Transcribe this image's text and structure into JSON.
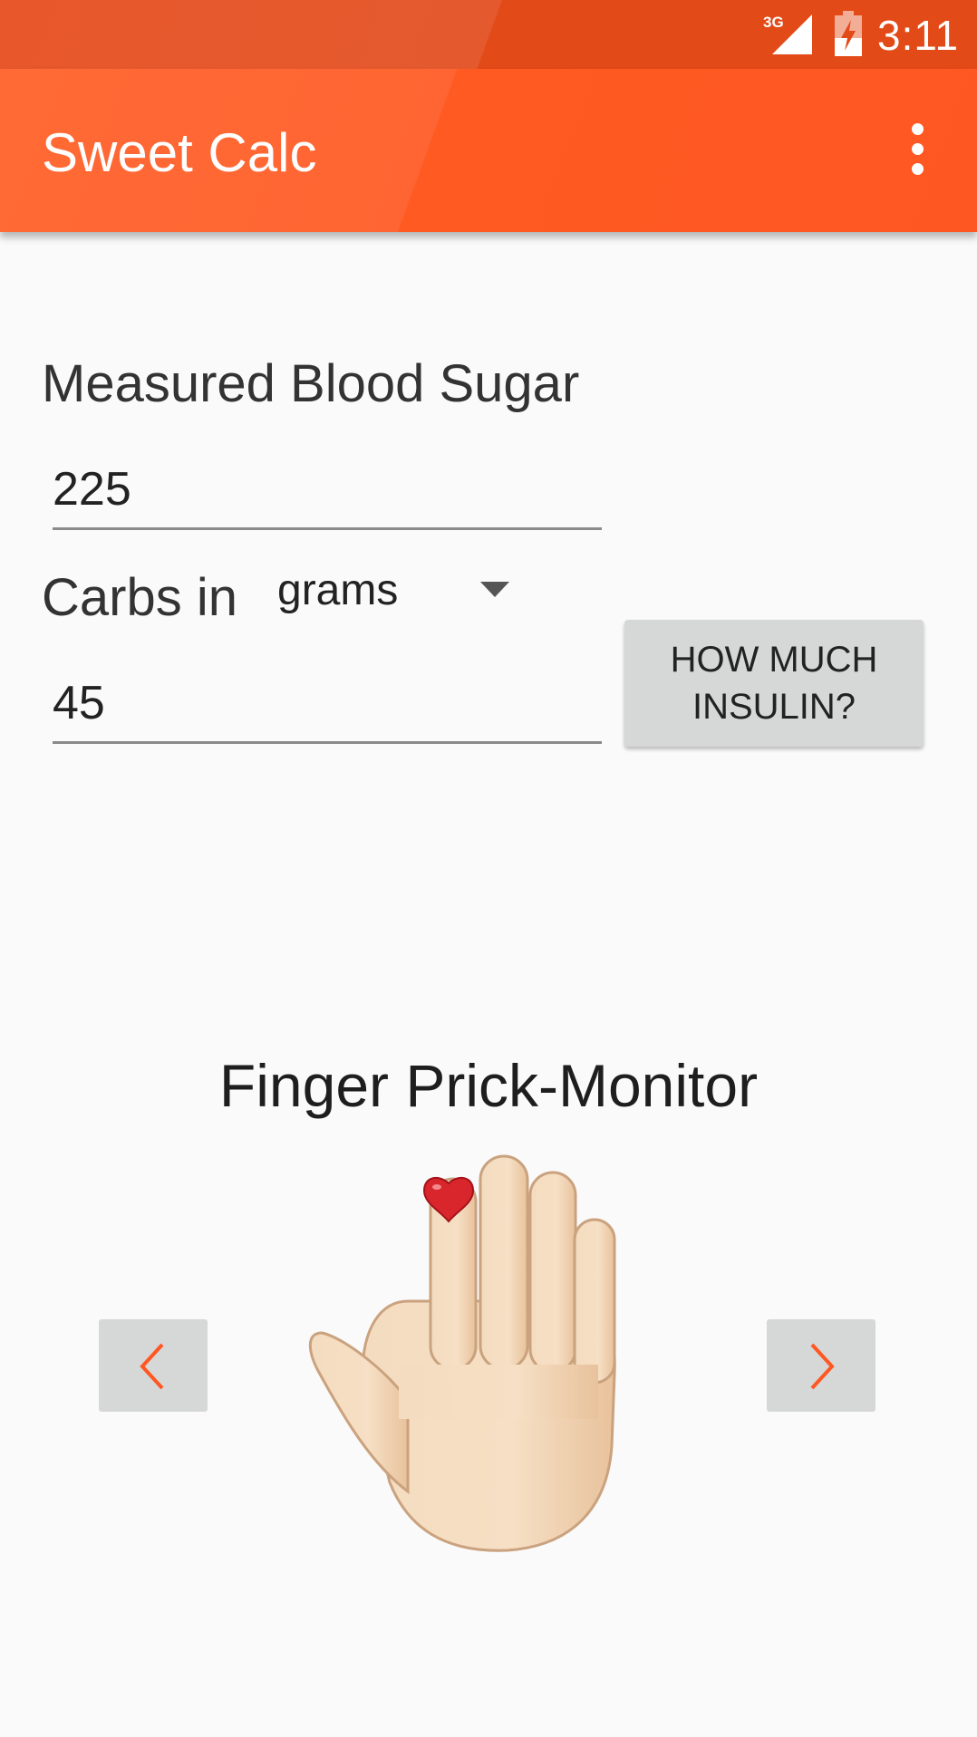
{
  "status_bar": {
    "network": "3G",
    "time": "3:11",
    "icons": [
      "signal-3g-icon",
      "battery-charging-icon"
    ]
  },
  "app_bar": {
    "title": "Sweet Calc",
    "menu_icon": "more-vert-icon"
  },
  "form": {
    "blood_sugar_label": "Measured Blood Sugar",
    "blood_sugar_value": "225",
    "carbs_label": "Carbs in",
    "carbs_unit": "grams",
    "carbs_value": "45",
    "calculate_button": "HOW MUCH\nINSULIN?"
  },
  "monitor": {
    "title": "Finger Prick-Monitor",
    "prev_icon": "chevron-left-icon",
    "next_icon": "chevron-right-icon",
    "image_icon": "raised-hand-icon",
    "marker_icon": "heart-icon"
  },
  "colors": {
    "primary": "#FF5722",
    "primary_dark": "#E64A19",
    "accent_arrow": "#FF5722",
    "button_bg": "#D6D7D7"
  }
}
